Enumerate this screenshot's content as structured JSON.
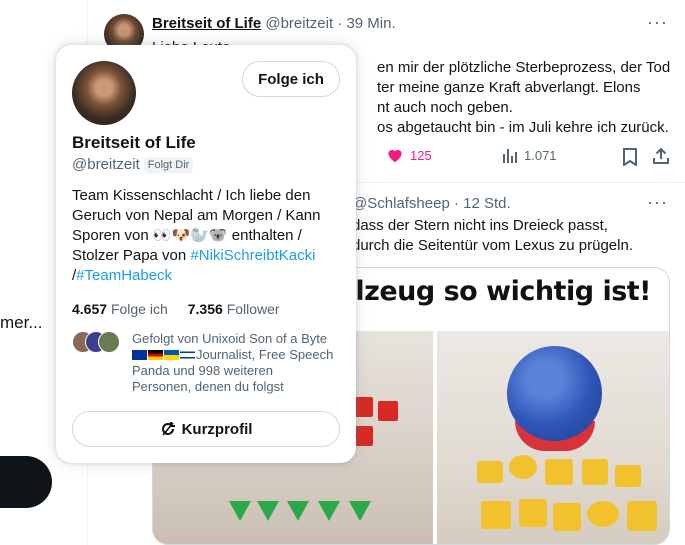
{
  "left": {
    "truncated_text": "mer..."
  },
  "tweet1": {
    "name": "Breitseit of Life",
    "handle": "@breitzeit",
    "time": "· 39 Min.",
    "lines": [
      "Liebe Leute,",
      "en mir der plötzliche Sterbeprozess, der Tod",
      "ter meine ganze Kraft abverlangt. Elons",
      "nt auch noch geben.",
      "os abgetaucht bin - im Juli kehre ich zurück."
    ],
    "likes": "125",
    "views": "1.071"
  },
  "tweet2": {
    "handle": "@Schlafsheep",
    "time": "· 12 Std.",
    "lines": [
      "dass der Stern nicht ins Dreieck passt,",
      "durch die Seitentür vom Lexus zu prügeln."
    ],
    "media_caption": "ielzeug so wichtig ist!"
  },
  "hovercard": {
    "follow_label": "Folge ich",
    "name": "Breitseit of Life",
    "handle": "@breitzeit",
    "follows_you": "Folgt Dir",
    "bio": {
      "line1": "Team Kissenschlacht   / Ich liebe den",
      "line2": "Geruch von Nepal am Morgen / Kann",
      "line3_prefix": "Sporen von ",
      "line3_emoji": "👀🐶🦭🐨",
      "line3_suffix": " enthalten  /",
      "line4_prefix": "Stolzer Papa von ",
      "hashtag1": "#NikiSchreibtKacki",
      "line5_prefix": "/",
      "hashtag2": "#TeamHabeck"
    },
    "following_count": "4.657",
    "following_label": "Folge ich",
    "followers_count": "7.356",
    "followers_label": "Follower",
    "followed_by": {
      "line1": "Gefolgt von Unixoid Son of a Byte",
      "line2": "Journalist, Free Speech",
      "line3": "Panda und 998 weiteren",
      "line4": "Personen, denen du folgst"
    },
    "profile_button_label": "Kurzprofil"
  }
}
